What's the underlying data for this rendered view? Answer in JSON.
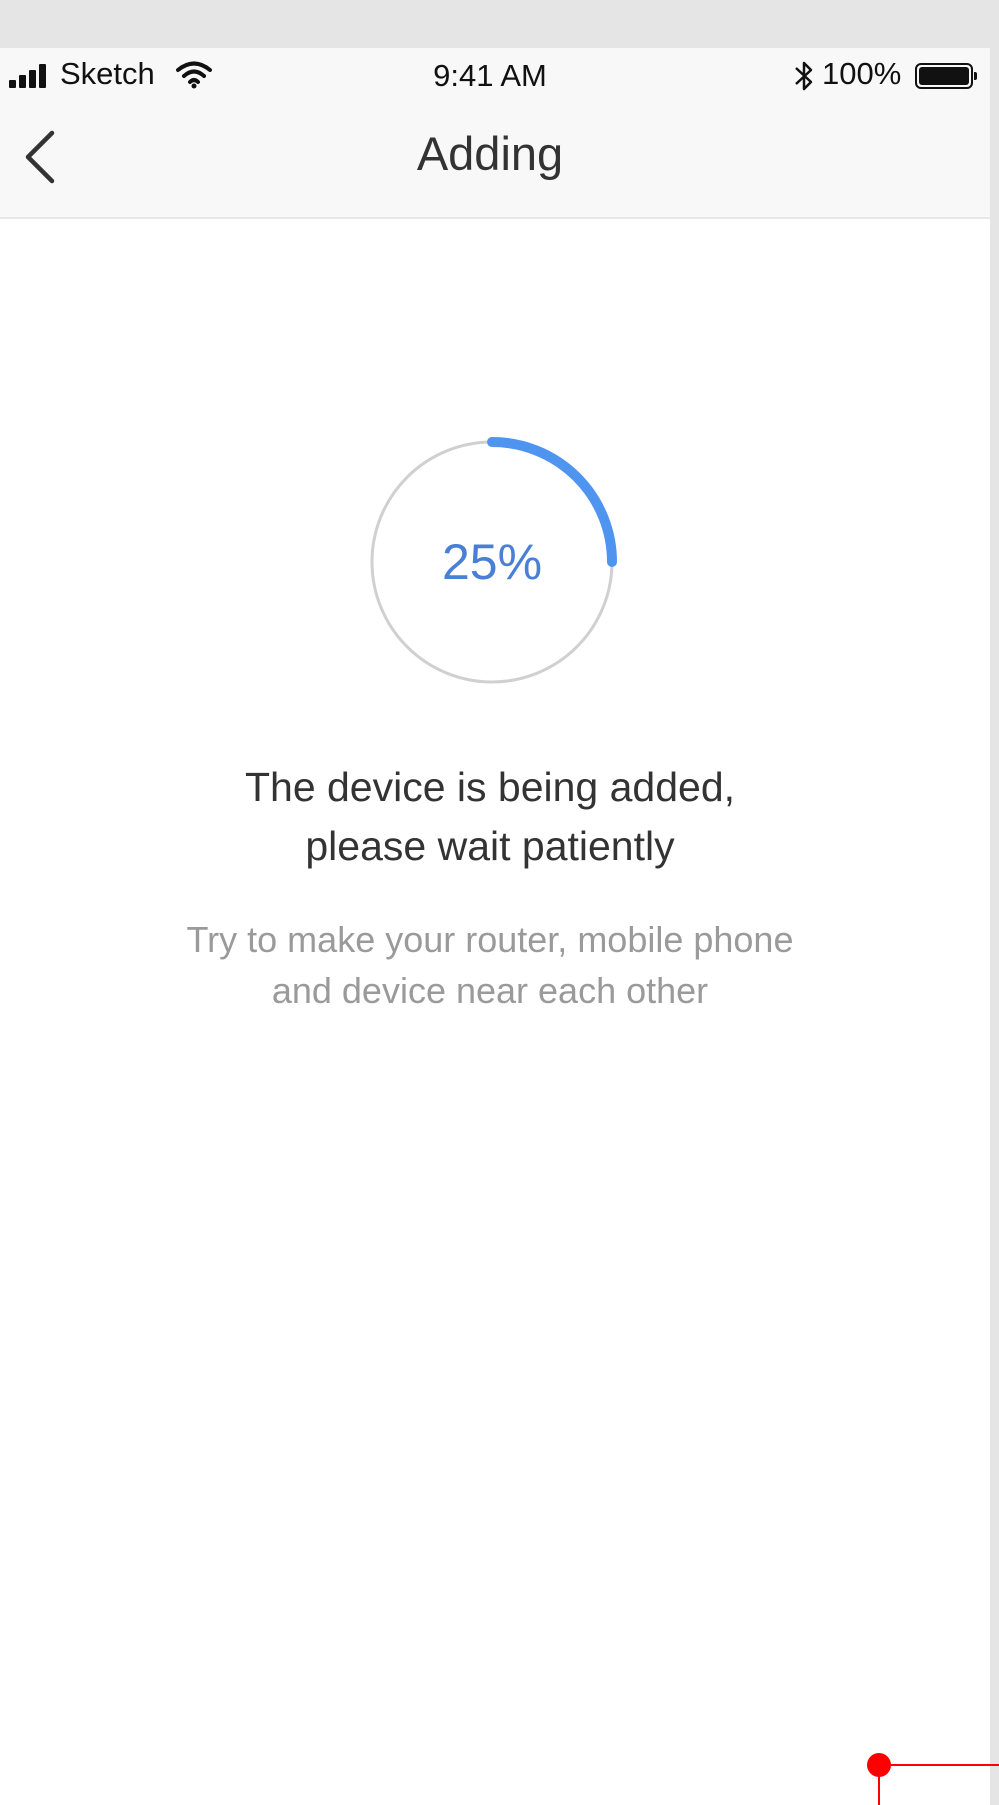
{
  "status_bar": {
    "carrier": "Sketch",
    "time": "9:41 AM",
    "battery_percent": "100%",
    "icons": [
      "signal-icon",
      "wifi-icon",
      "bluetooth-icon",
      "battery-icon"
    ]
  },
  "nav": {
    "title": "Adding",
    "back_icon": "chevron-left-icon"
  },
  "progress": {
    "value": 0.25,
    "label": "25%",
    "track_color": "#d0d0d0",
    "fill_color": "#4f95f0",
    "label_color": "#4a7fd6"
  },
  "message": {
    "line1": "The device is being added,",
    "line2": "please wait patiently"
  },
  "hint": {
    "line1": "Try to make your router, mobile phone",
    "line2": "and device near each other"
  },
  "colors": {
    "header_bg": "#f8f8f8",
    "screen_bg": "#ffffff",
    "annotation": "#ff0000"
  }
}
